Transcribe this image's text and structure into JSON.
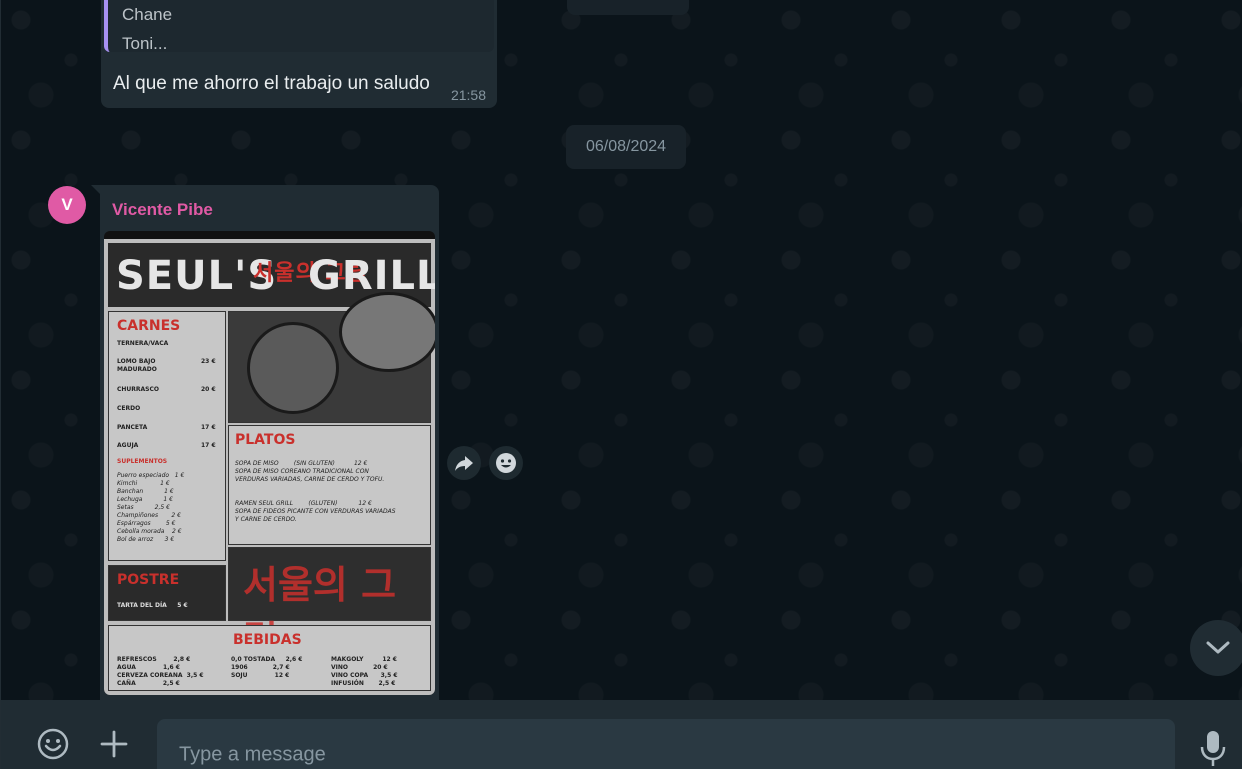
{
  "chat": {
    "quoted_message": {
      "lines": [
        "Chane",
        "Toni..."
      ]
    },
    "message_1": {
      "text": "Al que me ahorro el trabajo un saludo",
      "time": "21:58"
    },
    "date_separator": "06/08/2024",
    "message_2": {
      "avatar_initial": "V",
      "sender": "Vicente Pibe",
      "media": {
        "kind": "image",
        "title": "SEUL'S",
        "title_korean": "서울의 그릴",
        "title_right": "GRILL",
        "sections": {
          "carnes": {
            "title": "CARNES",
            "subtitle": "TERNERA/VACA",
            "items": [
              {
                "name": "LOMO BAJO\nMADURADO",
                "price": "23 €"
              },
              {
                "name": "CHURRASCO",
                "price": "20 €"
              },
              {
                "name": "CERDO",
                "price": ""
              },
              {
                "name": "PANCETA",
                "price": "17 €"
              },
              {
                "name": "AGUJA",
                "price": "17 €"
              }
            ],
            "suplementos_title": "SUPLEMENTOS",
            "suplementos": "Puerro especiado   1 €\nKimchi            1 €\nBanchan           1 €\nLechuga           1 €\nSetas           2,5 €\nChampiñones       2 €\nEspárragos        5 €\nCebolla morada    2 €\nBol de arroz      3 €"
          },
          "platos": {
            "title": "PLATOS",
            "items": "SOPA DE MISO        (SIN GLUTEN)          12 €\nSOPA DE MISO COREANO TRADICIONAL CON\nVERDURAS VARIADAS, CARNE DE CERDO Y TOFU.\n\n\nRAMEN SEUL GRILL        (GLUTEN)           12 €\nSOPA DE FIDEOS PICANTE CON VERDURAS VARIADAS\nY CARNE DE CERDO."
          },
          "postre": {
            "title": "POSTRE",
            "items": "TARTA DEL DÍA     5 €"
          },
          "bebidas": {
            "title": "BEBIDAS",
            "col1": "REFRESCOS        2,8 €\nAGUA             1,6 €\nCERVEZA COREANA  3,5 €\nCAÑA             2,5 €",
            "col2": "0,0 TOSTADA     2,6 €\n1906            2,7 €\nSOJU             12 €",
            "col3": "MAKGOLY         12 €\nVINO            20 €\nVINO COPA      3,5 €\nINFUSIÓN       2,5 €"
          }
        }
      }
    }
  },
  "actions": {
    "forward_icon": "forward-icon",
    "react_icon": "emoji-react-icon",
    "scroll_down_icon": "chevron-down-icon"
  },
  "composer": {
    "placeholder": "Type a message",
    "emoji_icon": "emoji-icon",
    "attach_icon": "plus-icon",
    "mic_icon": "microphone-icon"
  },
  "colors": {
    "background": "#0b141a",
    "bubble": "#202c33",
    "sender_name": "#e05aa5",
    "quote_bar": "#a791f2",
    "secondary_text": "#8696a0"
  }
}
